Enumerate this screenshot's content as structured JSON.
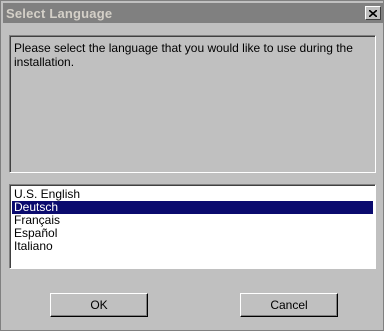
{
  "window": {
    "title": "Select Language",
    "close_icon": "close-icon"
  },
  "message": "Please select the language that you would like to use during the installation.",
  "languages": {
    "items": [
      "U.S. English",
      "Deutsch",
      "Français",
      "Español",
      "Italiano"
    ],
    "selected": "Deutsch"
  },
  "buttons": {
    "ok_label": "OK",
    "cancel_label": "Cancel"
  },
  "colors": {
    "titlebar": "#808080",
    "selection": "#0a0a6e",
    "face": "#c0c0c0"
  }
}
